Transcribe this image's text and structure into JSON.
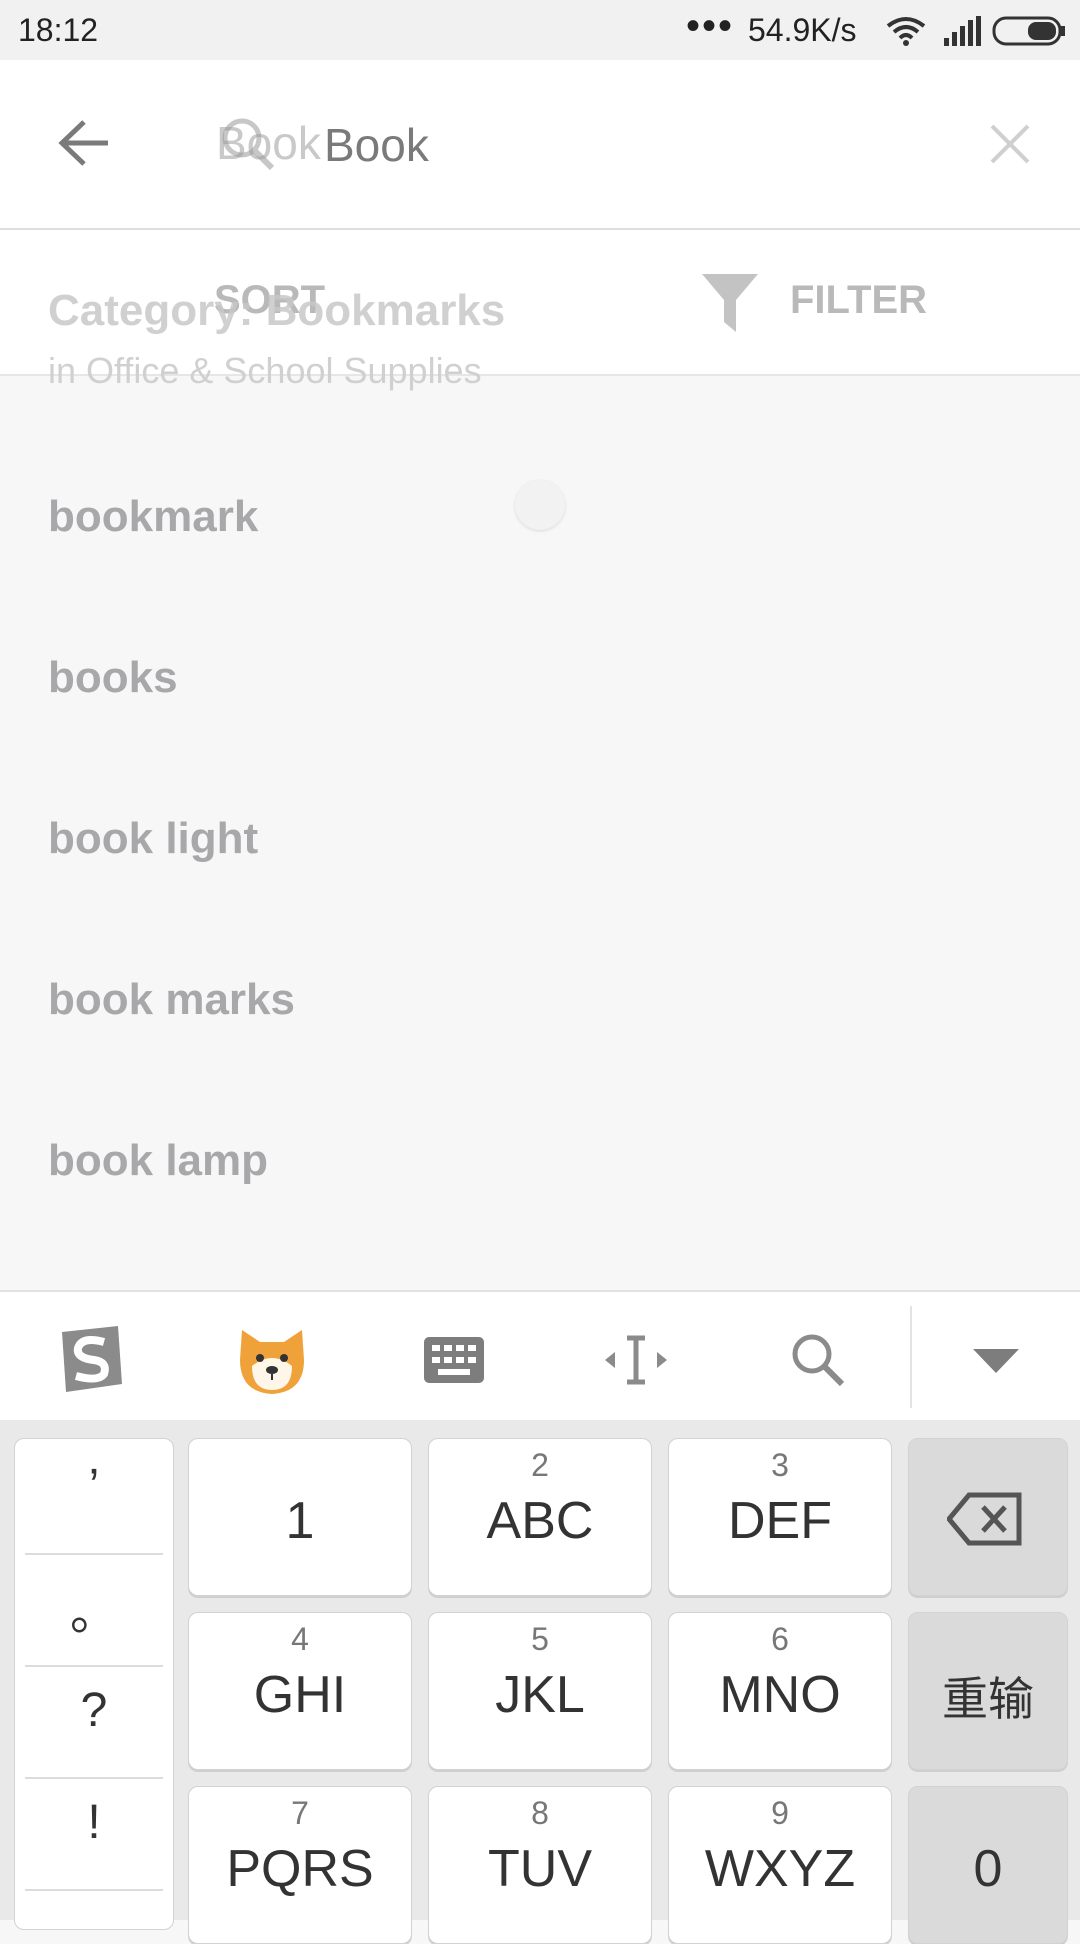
{
  "status_bar": {
    "time": "18:12",
    "dots": "•••",
    "network_speed": "54.9K/s"
  },
  "search": {
    "ghost_text": "Book",
    "query": "Book"
  },
  "sort_filter": {
    "sort_label": "SORT",
    "filter_label": "FILTER"
  },
  "suggestions": {
    "category_title": "Category: Bookmarks",
    "category_subtitle": "in Office & School Supplies",
    "items": [
      "bookmark",
      "books",
      "book light",
      "book marks",
      "book lamp"
    ]
  },
  "keyboard": {
    "punctuation": [
      "’",
      "。",
      "?",
      "!"
    ],
    "keys": {
      "k1": {
        "num": "",
        "label": "1"
      },
      "k2": {
        "num": "2",
        "label": "ABC"
      },
      "k3": {
        "num": "3",
        "label": "DEF"
      },
      "k4": {
        "num": "4",
        "label": "GHI"
      },
      "k5": {
        "num": "5",
        "label": "JKL"
      },
      "k6": {
        "num": "6",
        "label": "MNO"
      },
      "k7": {
        "num": "7",
        "label": "PQRS"
      },
      "k8": {
        "num": "8",
        "label": "TUV"
      },
      "k9": {
        "num": "9",
        "label": "WXYZ"
      },
      "reenter": "重输",
      "zero": "0"
    }
  }
}
